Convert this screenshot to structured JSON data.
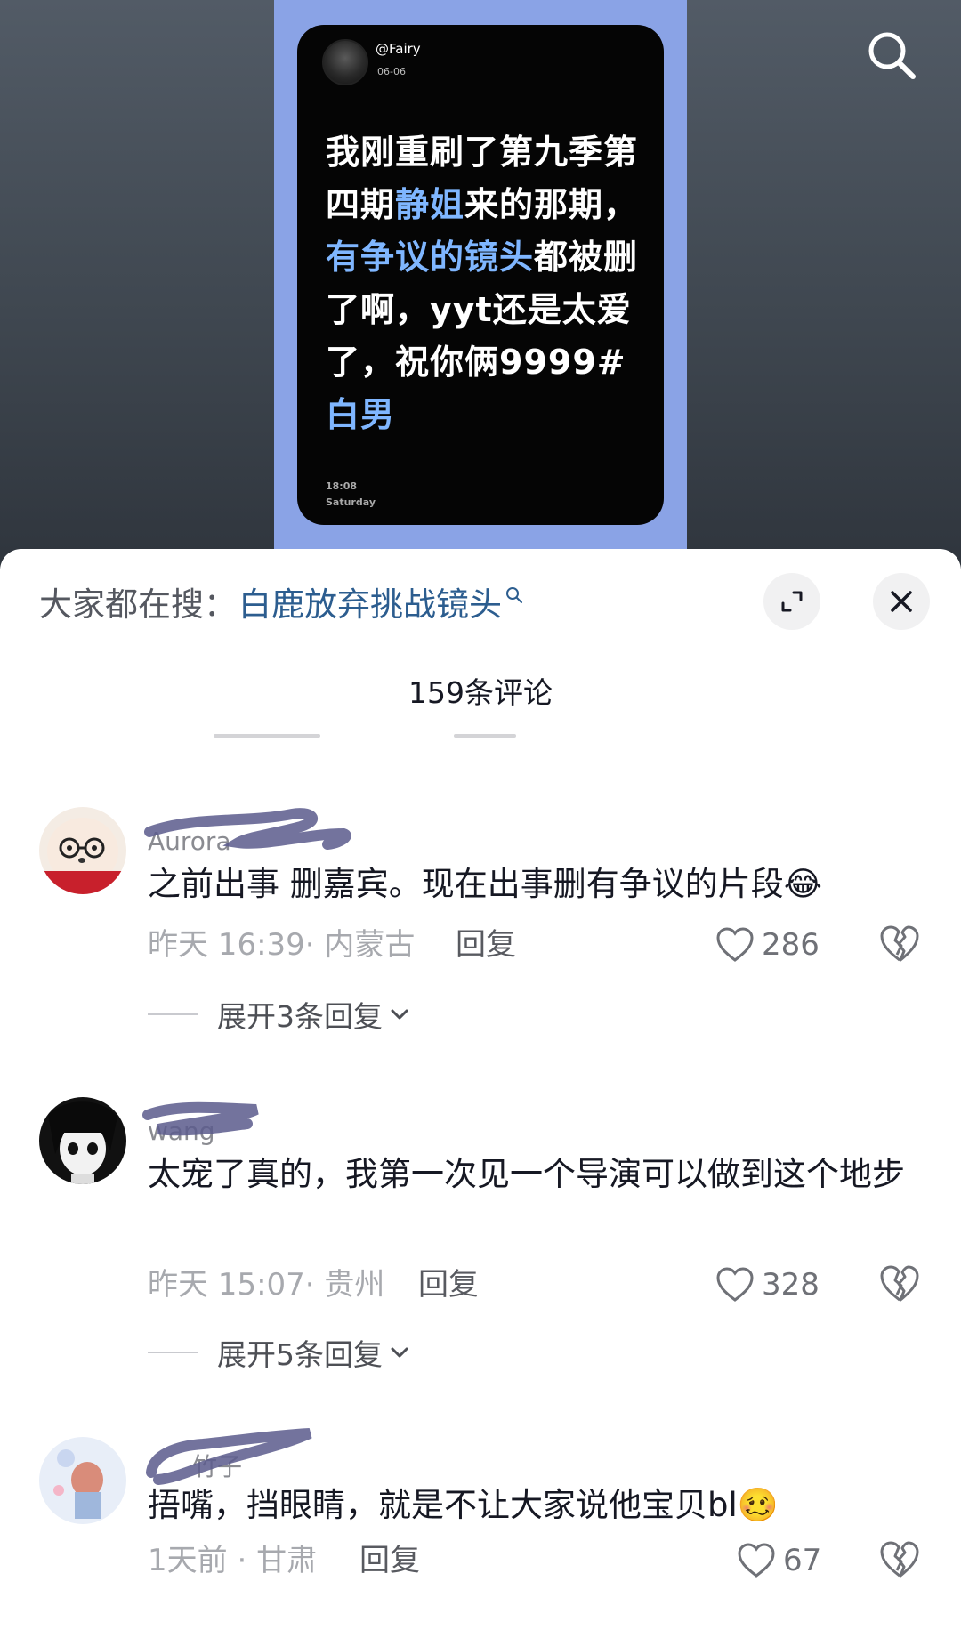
{
  "post": {
    "username": "@Fairy",
    "date": "06-06",
    "text_parts": [
      {
        "t": "我刚重刷了第九季第四期",
        "hl": false
      },
      {
        "t": "静姐",
        "hl": true
      },
      {
        "t": "来的那期，",
        "hl": false
      },
      {
        "t": "有争议的镜头",
        "hl": true
      },
      {
        "t": "都被删了啊，yyt还是太爱了，祝你俩9999#",
        "hl": false
      },
      {
        "t": "白男",
        "hl": true
      }
    ],
    "time": "18:08",
    "weekday": "Saturday",
    "highlight_color": "#7fb6ff"
  },
  "top_search_icon": "search-icon",
  "sheet": {
    "search_prefix": "大家都在搜：",
    "search_keyword": "白鹿放弃挑战镜头",
    "comment_count": "159条评论",
    "expand_icon": "expand-icon",
    "close_icon": "close-icon"
  },
  "comments": [
    {
      "name": "Aurora",
      "text": "之前出事 删嘉宾。现在出事删有争议的片段😂",
      "time": "昨天 16:39",
      "location": "内蒙古",
      "reply": "回复",
      "likes": "286",
      "expand": "展开3条回复"
    },
    {
      "name": "wang",
      "text": "太宠了真的，我第一次见一个导演可以做到这个地步",
      "time": "昨天 15:07",
      "location": "贵州",
      "reply": "回复",
      "likes": "328",
      "expand": "展开5条回复"
    },
    {
      "name": "竹子",
      "text": "捂嘴，挡眼睛，就是不让大家说他宝贝bl🥴",
      "time": "1天前",
      "location": "甘肃",
      "reply": "回复",
      "likes": "67"
    }
  ]
}
